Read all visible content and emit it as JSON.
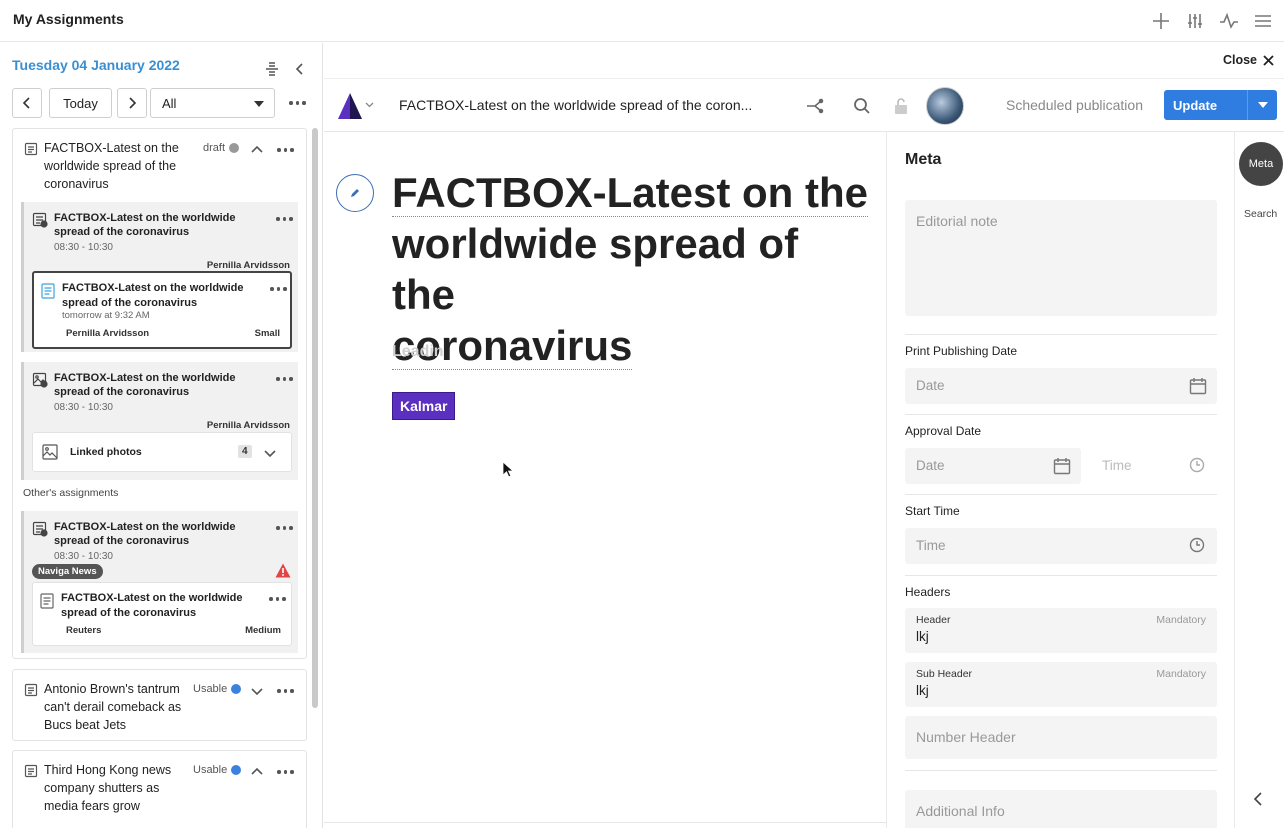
{
  "app": {
    "title": "My Assignments"
  },
  "header_icons": [
    "plus-icon",
    "sliders-icon",
    "activity-icon",
    "menu-icon"
  ],
  "planner": {
    "date": "Tuesday 04 January 2022",
    "today_label": "Today",
    "filter_value": "All",
    "groups": [
      {
        "title": "FACTBOX-Latest on the worldwide spread of the coronavirus",
        "status": "draft",
        "status_color": "#999999",
        "cards": [
          {
            "title": "FACTBOX-Latest on the worldwide spread of the coronavirus",
            "time": "08:30 - 10:30",
            "author": "Pernilla Arvidsson",
            "sub": {
              "title": "FACTBOX-Latest on the worldwide spread of the coronavirus",
              "time": "tomorrow at 9:32 AM",
              "author": "Pernilla Arvidsson",
              "size": "Small"
            }
          },
          {
            "title": "FACTBOX-Latest on the worldwide spread of the coronavirus",
            "time": "08:30 - 10:30",
            "author": "Pernilla Arvidsson",
            "linked_photos_label": "Linked photos",
            "linked_photos_count": "4"
          }
        ],
        "others_label": "Other's assignments",
        "other_card": {
          "title": "FACTBOX-Latest on the worldwide spread of the coronavirus",
          "time": "08:30 - 10:30",
          "badge": "Naviga News",
          "sub": {
            "title": "FACTBOX-Latest on the worldwide spread of the coronavirus",
            "source": "Reuters",
            "size": "Medium"
          }
        }
      },
      {
        "title": "Antonio Brown's tantrum can't derail comeback as Bucs beat Jets",
        "status": "Usable",
        "status_color": "#3b82e0"
      },
      {
        "title": "Third Hong Kong news company shutters as media fears grow",
        "status": "Usable",
        "status_color": "#3b82e0"
      }
    ]
  },
  "editor": {
    "close_label": "Close",
    "doc_title": "FACTBOX-Latest on the worldwide spread of the coron...",
    "scheduled_label": "Scheduled publication",
    "update_label": "Update",
    "headline_line1": "FACTBOX-Latest on the",
    "headline_line2": "worldwide spread of the",
    "headline_line3": "coronavirus",
    "leadin_placeholder": "Leadin",
    "tag": "Kalmar",
    "tag_color": "#5b2fc0",
    "accent_color": "#2f7de0"
  },
  "meta": {
    "title": "Meta",
    "editorial_note_placeholder": "Editorial note",
    "print_publishing_date_label": "Print Publishing Date",
    "date_placeholder": "Date",
    "approval_date_label": "Approval Date",
    "time_placeholder": "Time",
    "start_time_label": "Start Time",
    "headers_label": "Headers",
    "header_label": "Header",
    "header_value": "lkj",
    "sub_header_label": "Sub Header",
    "sub_header_value": "lkj",
    "mandatory_label": "Mandatory",
    "number_header_placeholder": "Number Header",
    "additional_info_placeholder": "Additional Info"
  },
  "rail": {
    "meta_label": "Meta",
    "search_label": "Search"
  }
}
